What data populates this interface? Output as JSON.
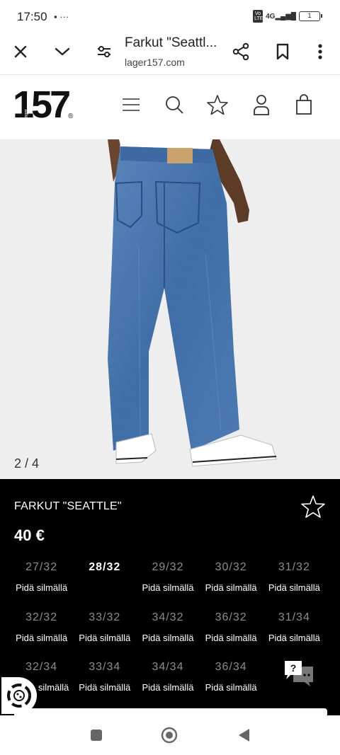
{
  "status": {
    "time": "17:50",
    "left_icons": "▪ ···",
    "volte": "Vo LTE",
    "signal": "4G",
    "battery": "1"
  },
  "browser": {
    "title": "Farkut \"Seattl...",
    "url": "lager157.com",
    "icons": [
      "close-icon",
      "chevron-down-icon",
      "tune-icon",
      "share-icon",
      "bookmark-icon",
      "more-vert-icon"
    ]
  },
  "site": {
    "logo_text": "157",
    "logo_sub": "Lager",
    "logo_reg": "®",
    "header_icons": [
      "menu-icon",
      "search-icon",
      "star-icon",
      "user-icon",
      "bag-icon"
    ]
  },
  "gallery": {
    "counter": "2 / 4"
  },
  "product": {
    "name": "FARKUT \"SEATTLE\"",
    "price": "40 €",
    "sizes": [
      {
        "label": "27/32",
        "note": "Pidä silmällä",
        "available": false
      },
      {
        "label": "28/32",
        "note": "",
        "available": true
      },
      {
        "label": "29/32",
        "note": "Pidä silmällä",
        "available": false
      },
      {
        "label": "30/32",
        "note": "Pidä silmällä",
        "available": false
      },
      {
        "label": "31/32",
        "note": "Pidä silmällä",
        "available": false
      },
      {
        "label": "32/32",
        "note": "Pidä silmällä",
        "available": false
      },
      {
        "label": "33/32",
        "note": "Pidä silmällä",
        "available": false
      },
      {
        "label": "34/32",
        "note": "Pidä silmällä",
        "available": false
      },
      {
        "label": "36/32",
        "note": "Pidä silmällä",
        "available": false
      },
      {
        "label": "31/34",
        "note": "Pidä silmällä",
        "available": false
      },
      {
        "label": "32/34",
        "note": "silmällä",
        "available": false
      },
      {
        "label": "33/34",
        "note": "Pidä silmällä",
        "available": false
      },
      {
        "label": "34/34",
        "note": "Pidä silmällä",
        "available": false
      },
      {
        "label": "36/34",
        "note": "Pidä silmällä",
        "available": false
      }
    ]
  },
  "chat": {
    "glyph": "?"
  },
  "colors": {
    "panel_bg": "#000000",
    "unavailable_size": "#8c8c8c",
    "image_bg": "#eeeeee",
    "denim": "#4a74a8"
  }
}
